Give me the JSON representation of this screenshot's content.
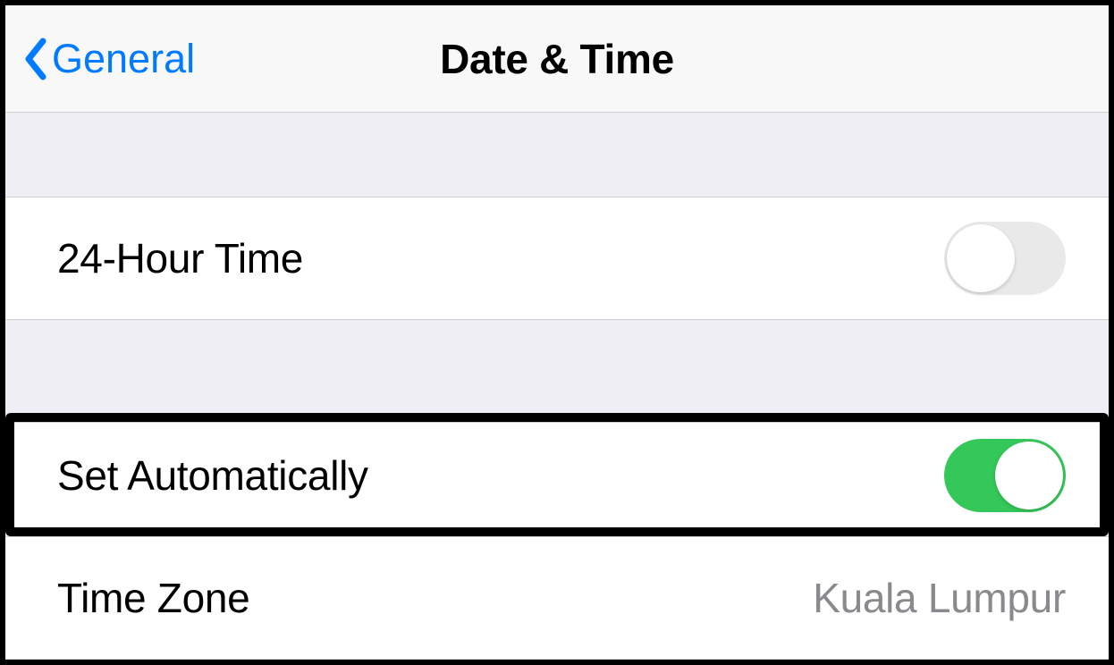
{
  "nav": {
    "back_label": "General",
    "title": "Date & Time"
  },
  "rows": {
    "twenty_four_hour": {
      "label": "24-Hour Time",
      "toggle_on": false
    },
    "set_auto": {
      "label": "Set Automatically",
      "toggle_on": true
    },
    "time_zone": {
      "label": "Time Zone",
      "value": "Kuala Lumpur"
    }
  }
}
